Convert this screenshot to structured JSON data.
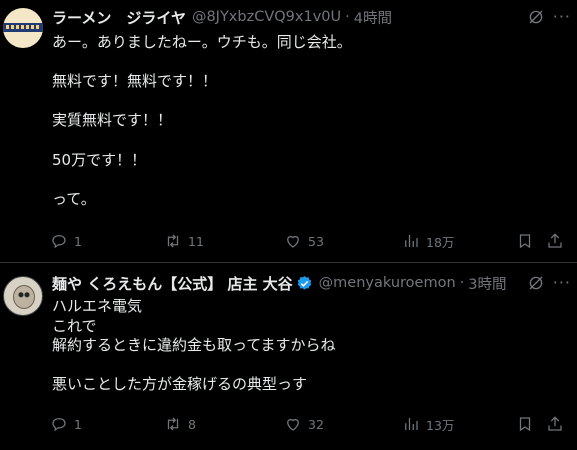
{
  "tweets": [
    {
      "name": "ラーメン　ジライヤ",
      "handle": "@8JYxbzCVQ9x1v0U",
      "dot": "·",
      "time": "4時間",
      "body": "あー。ありましたねー。ウチも。同じ会社。\n\n無料です！無料です！！\n\n実質無料です！！\n\n50万です！！\n\nって。",
      "verified": false,
      "stats": {
        "replies": "1",
        "reposts": "11",
        "likes": "53",
        "views": "18万"
      }
    },
    {
      "name": "麺や くろえもん【公式】 店主 大谷",
      "handle": "@menyakuroemon",
      "dot": "·",
      "time": "3時間",
      "body": "ハルエネ電気\nこれで\n解約するときに違約金も取ってますからね\n\n悪いことした方が金稼げるの典型っす",
      "verified": true,
      "stats": {
        "replies": "1",
        "reposts": "8",
        "likes": "32",
        "views": "13万"
      }
    }
  ],
  "more_glyph": "···",
  "colors": {
    "background": "#000000",
    "text": "#e7e9ea",
    "muted": "#71767b",
    "verified": "#1d9bf0",
    "divider": "#2f3336"
  },
  "icons": [
    "grok-icon",
    "more-icon",
    "reply-icon",
    "repost-icon",
    "like-icon",
    "views-icon",
    "bookmark-icon",
    "share-icon",
    "verified-badge-icon"
  ]
}
